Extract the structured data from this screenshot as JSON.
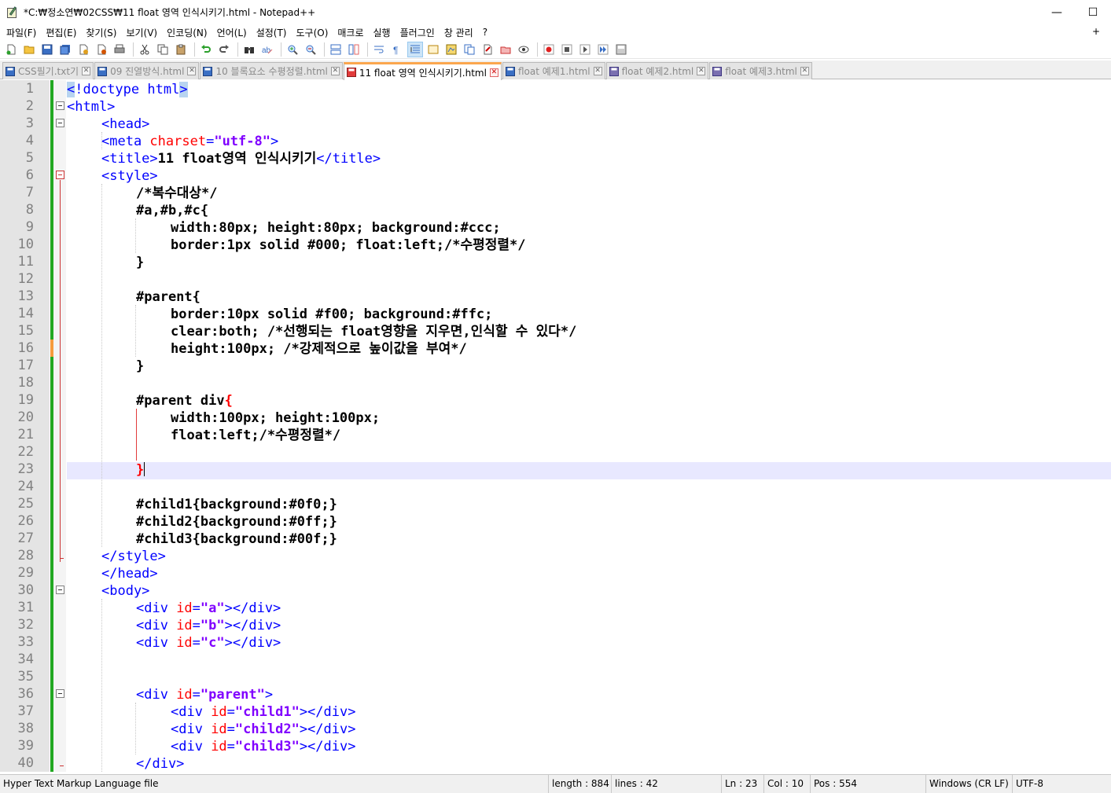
{
  "window": {
    "title": "*C:₩정소연₩02CSS₩11 float 영역 인식시키기.html - Notepad++",
    "minimize": "—",
    "maximize": "☐"
  },
  "menu": {
    "items": [
      "파일(F)",
      "편집(E)",
      "찾기(S)",
      "보기(V)",
      "인코딩(N)",
      "언어(L)",
      "설정(T)",
      "도구(O)",
      "매크로",
      "실행",
      "플러그인",
      "창 관리",
      "?"
    ],
    "plus": "+"
  },
  "tabs": [
    {
      "label": "CSS필기.txt기",
      "active": false
    },
    {
      "label": "09 진열방식.html",
      "active": false
    },
    {
      "label": "10 블록요소 수평정렬.html",
      "active": false
    },
    {
      "label": "11 float 영역 인식시키기.html",
      "active": true
    },
    {
      "label": "float 예제1.html",
      "active": false
    },
    {
      "label": "float 예제2.html",
      "active": false
    },
    {
      "label": "float 예제3.html",
      "active": false
    }
  ],
  "editor": {
    "current_line": 23,
    "lines": [
      {
        "n": "1"
      },
      {
        "n": "2"
      },
      {
        "n": "3"
      },
      {
        "n": "4"
      },
      {
        "n": "5"
      },
      {
        "n": "6"
      },
      {
        "n": "7"
      },
      {
        "n": "8"
      },
      {
        "n": "9"
      },
      {
        "n": "10"
      },
      {
        "n": "11"
      },
      {
        "n": "12"
      },
      {
        "n": "13"
      },
      {
        "n": "14"
      },
      {
        "n": "15"
      },
      {
        "n": "16"
      },
      {
        "n": "17"
      },
      {
        "n": "18"
      },
      {
        "n": "19"
      },
      {
        "n": "20"
      },
      {
        "n": "21"
      },
      {
        "n": "22"
      },
      {
        "n": "23"
      },
      {
        "n": "24"
      },
      {
        "n": "25"
      },
      {
        "n": "26"
      },
      {
        "n": "27"
      },
      {
        "n": "28"
      },
      {
        "n": "29"
      },
      {
        "n": "30"
      },
      {
        "n": "31"
      },
      {
        "n": "32"
      },
      {
        "n": "33"
      },
      {
        "n": "34"
      },
      {
        "n": "35"
      },
      {
        "n": "36"
      },
      {
        "n": "37"
      },
      {
        "n": "38"
      },
      {
        "n": "39"
      },
      {
        "n": "40"
      }
    ],
    "code": {
      "l1": {
        "open": "<",
        "text": "!doctype html",
        "close": ">"
      },
      "l2": "<html>",
      "l3": "<head>",
      "l4": {
        "tag": "<meta ",
        "attr": "charset",
        "eq": "=",
        "val": "\"utf-8\"",
        "end": ">"
      },
      "l5": {
        "tag": "<title>",
        "text": "11 float영역 인식시키기",
        "end": "</title>"
      },
      "l6": "<style>",
      "l7": "/*복수대상*/",
      "l8": "#a,#b,#c{",
      "l9": "width:80px; height:80px; background:#ccc;",
      "l10": "border:1px solid #000; float:left;/*수평정렬*/",
      "l11": "}",
      "l13": "#parent{",
      "l14": "border:10px solid #f00; background:#ffc;",
      "l15": "clear:both; /*선행되는 float영향을 지우면,인식할 수 있다*/",
      "l16": "height:100px; /*강제적으로 높이값을 부여*/",
      "l17": "}",
      "l19": {
        "sel": "#parent div",
        "brace": "{"
      },
      "l20": "width:100px; height:100px;",
      "l21": "float:left;/*수평정렬*/",
      "l23": "}",
      "l25": "#child1{background:#0f0;}",
      "l26": "#child2{background:#0ff;}",
      "l27": "#child3{background:#00f;}",
      "l28": "</style>",
      "l29": "</head>",
      "l30": "<body>",
      "l31": {
        "tag": "<div ",
        "attr": "id",
        "eq": "=",
        "val": "\"a\"",
        "end": "></div>"
      },
      "l32": {
        "tag": "<div ",
        "attr": "id",
        "eq": "=",
        "val": "\"b\"",
        "end": "></div>"
      },
      "l33": {
        "tag": "<div ",
        "attr": "id",
        "eq": "=",
        "val": "\"c\"",
        "end": "></div>"
      },
      "l36": {
        "tag": "<div ",
        "attr": "id",
        "eq": "=",
        "val": "\"parent\"",
        "end": ">"
      },
      "l37": {
        "tag": "<div ",
        "attr": "id",
        "eq": "=",
        "val": "\"child1\"",
        "end": "></div>"
      },
      "l38": {
        "tag": "<div ",
        "attr": "id",
        "eq": "=",
        "val": "\"child2\"",
        "end": "></div>"
      },
      "l39": {
        "tag": "<div ",
        "attr": "id",
        "eq": "=",
        "val": "\"child3\"",
        "end": "></div>"
      },
      "l40": "</div>"
    }
  },
  "status": {
    "file_type": "Hyper Text Markup Language file",
    "length": "length : 884",
    "lines": "lines : 42",
    "ln": "Ln : 23",
    "col": "Col : 10",
    "pos": "Pos : 554",
    "eol": "Windows (CR LF)",
    "encoding": "UTF-8"
  },
  "colors": {
    "tag": "#0000ff",
    "attribute": "#ff0000",
    "value": "#8000ff",
    "change_marker": "#22a822",
    "active_tab_accent": "#fba64d",
    "current_line": "#e8e8ff"
  }
}
